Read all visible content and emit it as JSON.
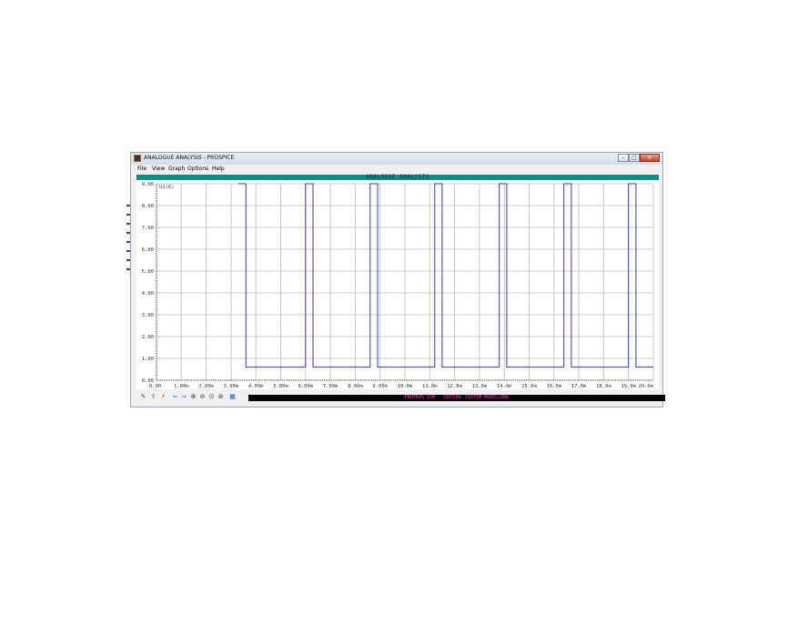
{
  "window": {
    "title": "ANALOGUE ANALYSIS - PROSPICE",
    "controls": {
      "minimize": "–",
      "maximize": "□",
      "close": "✕"
    }
  },
  "menu": {
    "items": [
      "File",
      "View",
      "Graph",
      "Options",
      "Help"
    ]
  },
  "graph": {
    "title": "ANALOGUE ANALYSIS",
    "trace_label": "U2(K)",
    "trace_color": "#3a3aa8",
    "grid_color": "#c8c8c8",
    "axis_label_color": "#333333"
  },
  "chart_data": {
    "type": "line",
    "title": "ANALOGUE ANALYSIS",
    "series": [
      {
        "name": "U2(K)",
        "x": [
          0.0,
          3.3,
          3.3,
          3.6,
          3.6,
          6.0,
          6.0,
          6.3,
          6.3,
          8.6,
          8.6,
          8.9,
          8.9,
          11.2,
          11.2,
          11.5,
          11.5,
          13.8,
          13.8,
          14.1,
          14.1,
          16.4,
          16.4,
          16.7,
          16.7,
          19.0,
          19.0,
          19.3,
          19.3,
          20.0
        ],
        "y": [
          null,
          null,
          9.0,
          9.0,
          0.6,
          0.6,
          9.0,
          9.0,
          0.6,
          0.6,
          9.0,
          9.0,
          0.6,
          0.6,
          9.0,
          9.0,
          0.6,
          0.6,
          9.0,
          9.0,
          0.6,
          0.6,
          9.0,
          9.0,
          0.6,
          0.6,
          9.0,
          9.0,
          0.6,
          0.6
        ]
      }
    ],
    "x_ticks": [
      "0.00",
      "1.00m",
      "2.00m",
      "3.00m",
      "4.00m",
      "5.00m",
      "6.00m",
      "7.00m",
      "8.00m",
      "9.00m",
      "10.0m",
      "11.0m",
      "12.0m",
      "13.0m",
      "14.0m",
      "15.0m",
      "16.0m",
      "17.0m",
      "18.0m",
      "19.0m",
      "20.0m"
    ],
    "y_ticks": [
      "0.00",
      "1.00",
      "2.00",
      "3.00",
      "4.00",
      "5.00",
      "6.00",
      "7.00",
      "8.00",
      "9.00"
    ],
    "xlim": [
      0,
      20
    ],
    "ylim": [
      0,
      9
    ],
    "grid": true
  },
  "toolbar": {
    "buttons": [
      {
        "icon": "edit-graph-icon",
        "glyph": "✎"
      },
      {
        "icon": "add-trace-icon",
        "glyph": "⇪"
      },
      {
        "icon": "simulate-icon",
        "glyph": "⚡"
      },
      {
        "icon": "arrow-left-icon",
        "glyph": "⇦"
      },
      {
        "icon": "arrow-right-icon",
        "glyph": "⇨"
      },
      {
        "icon": "zoom-in-icon",
        "glyph": "⊕"
      },
      {
        "icon": "zoom-out-icon",
        "glyph": "⊖"
      },
      {
        "icon": "zoom-all-icon",
        "glyph": "⊙"
      },
      {
        "icon": "zoom-area-icon",
        "glyph": "⊚"
      },
      {
        "icon": "graph-view-icon",
        "glyph": "▦"
      }
    ],
    "status_text": "PROTEUS VSM - VIRTUAL SYSTEM MODELLING"
  }
}
